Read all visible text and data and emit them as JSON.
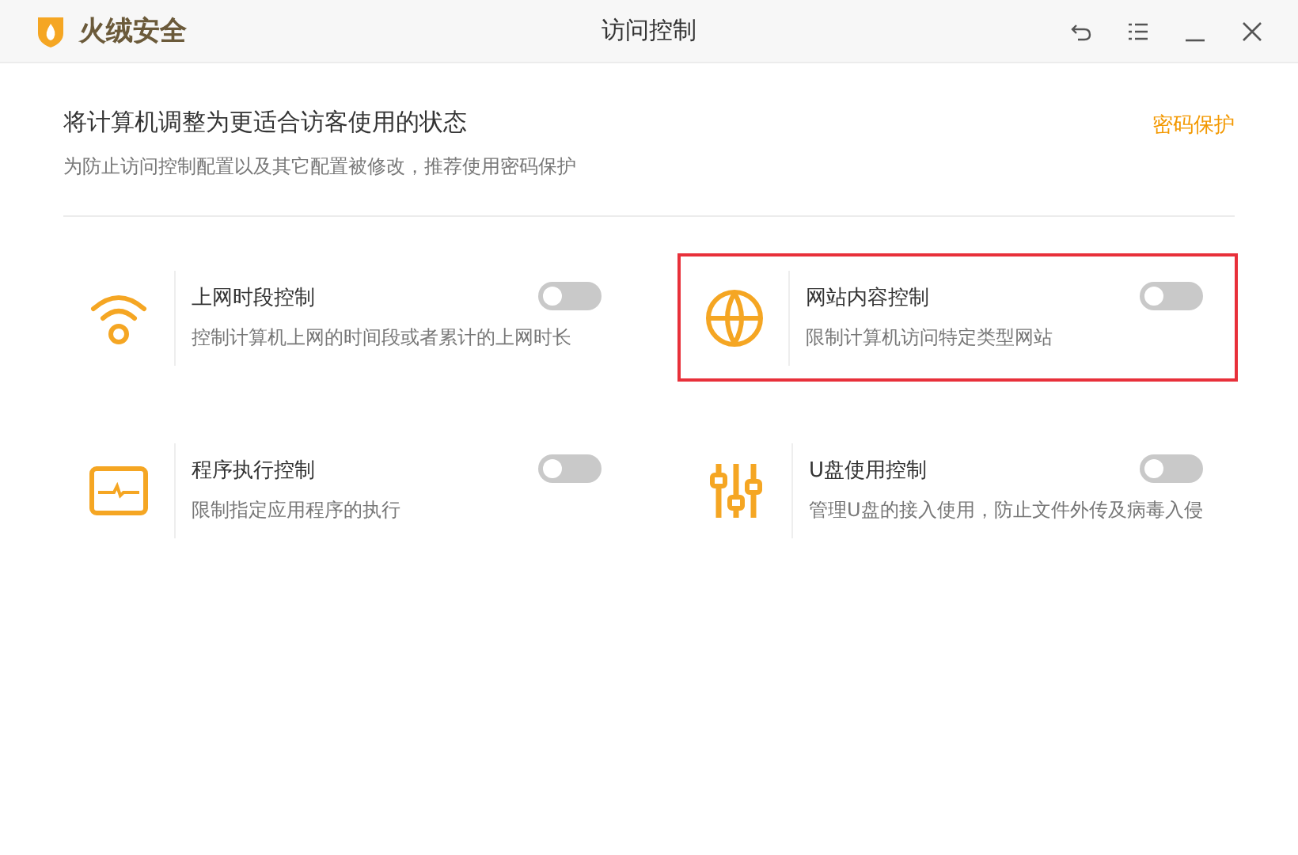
{
  "window": {
    "app_name": "火绒安全",
    "title": "访问控制"
  },
  "header": {
    "heading": "将计算机调整为更适合访客使用的状态",
    "description": "为防止访问控制配置以及其它配置被修改，推荐使用密码保护",
    "link": "密码保护"
  },
  "controls": [
    {
      "kind": "wifi",
      "title": "上网时段控制",
      "description": "控制计算机上网的时间段或者累计的上网时长",
      "on": false,
      "highlighted": false
    },
    {
      "kind": "globe",
      "title": "网站内容控制",
      "description": "限制计算机访问特定类型网站",
      "on": false,
      "highlighted": true
    },
    {
      "kind": "monitor",
      "title": "程序执行控制",
      "description": "限制指定应用程序的执行",
      "on": false,
      "highlighted": false
    },
    {
      "kind": "sliders",
      "title": "U盘使用控制",
      "description": "管理U盘的接入使用，防止文件外传及病毒入侵",
      "on": false,
      "highlighted": false
    }
  ]
}
